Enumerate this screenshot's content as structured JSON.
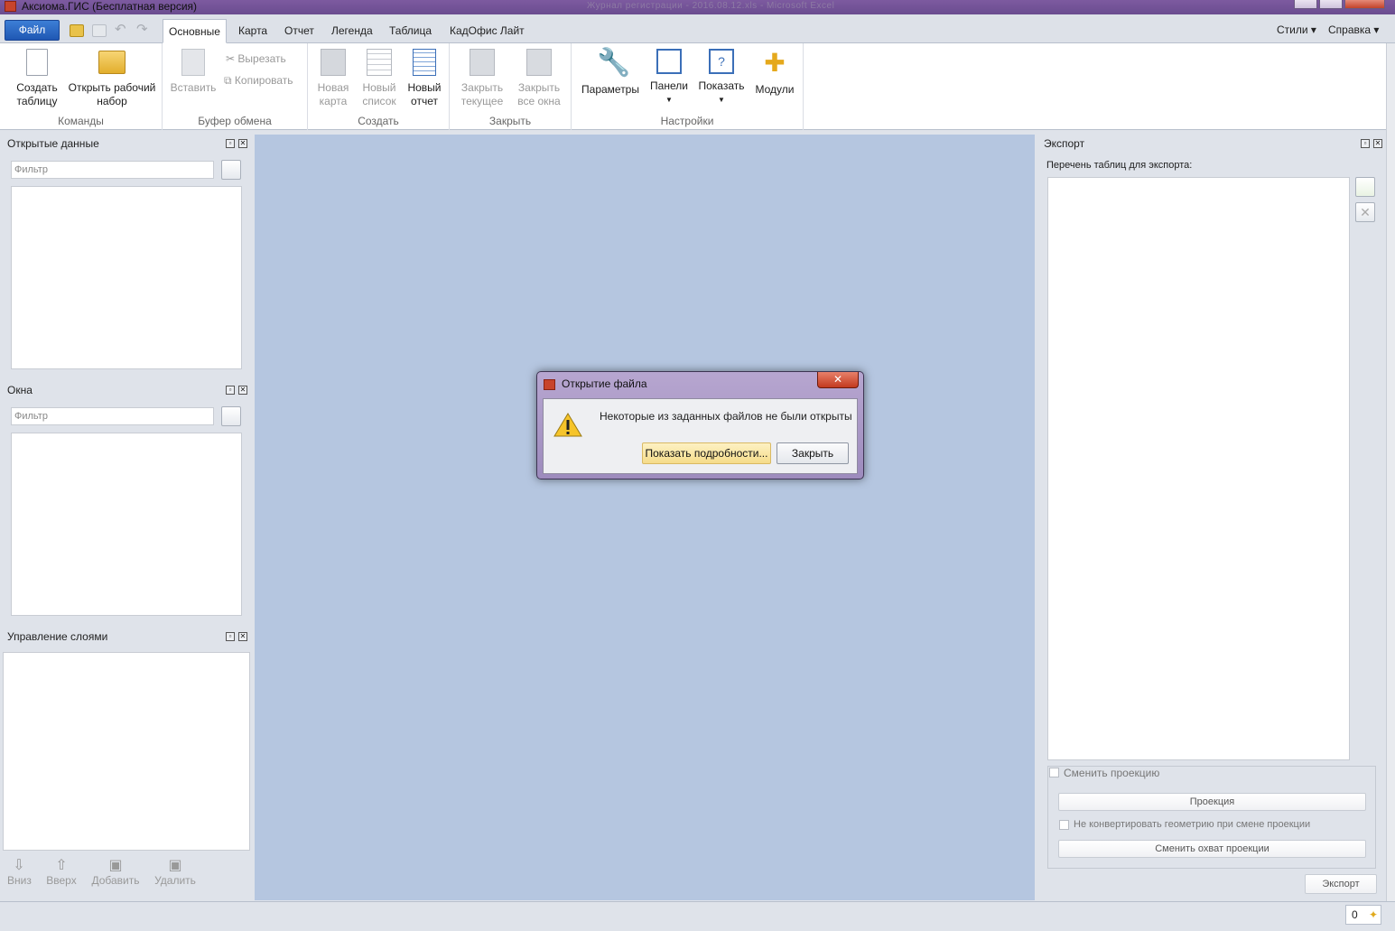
{
  "window": {
    "title": "Аксиома.ГИС (Бесплатная версия)",
    "background_title": "Журнал регистрации - 2016.08.12.xls - Microsoft Excel"
  },
  "ribbon": {
    "file_label": "Файл",
    "tabs": [
      "Основные",
      "Карта",
      "Отчет",
      "Легенда",
      "Таблица",
      "КадОфис Лайт"
    ],
    "active_tab": "Основные",
    "right_menus": [
      "Стили",
      "Справка"
    ],
    "groups": {
      "commands": {
        "label": "Команды",
        "create_table": [
          "Создать",
          "таблицу"
        ],
        "open_workspace": [
          "Открыть рабочий",
          "набор"
        ]
      },
      "clipboard": {
        "label": "Буфер обмена",
        "paste": "Вставить",
        "cut": "Вырезать",
        "copy": "Копировать"
      },
      "create": {
        "label": "Создать",
        "new_map": [
          "Новая",
          "карта"
        ],
        "new_list": [
          "Новый",
          "список"
        ],
        "new_report": [
          "Новый",
          "отчет"
        ]
      },
      "close": {
        "label": "Закрыть",
        "close_current": [
          "Закрыть",
          "текущее"
        ],
        "close_all": [
          "Закрыть",
          "все окна"
        ]
      },
      "settings": {
        "label": "Настройки",
        "params": "Параметры",
        "panels": "Панели",
        "show": "Показать",
        "modules": "Модули"
      }
    }
  },
  "left": {
    "open_data": {
      "title": "Открытые данные",
      "filter_placeholder": "Фильтр"
    },
    "windows": {
      "title": "Окна",
      "filter_placeholder": "Фильтр"
    },
    "layers": {
      "title": "Управление слоями",
      "actions": [
        "Вниз",
        "Вверх",
        "Добавить",
        "Удалить"
      ]
    }
  },
  "export": {
    "title": "Экспорт",
    "list_label": "Перечень таблиц для экспорта:",
    "change_projection": "Сменить проекцию",
    "projection_button": "Проекция",
    "no_convert": "Не конвертировать геометрию при смене проекции",
    "change_extent": "Сменить охват проекции",
    "export_button": "Экспорт"
  },
  "dialog": {
    "title": "Открытие файла",
    "close_glyph": "✕",
    "message": "Некоторые из заданных файлов не были открыты",
    "details_button": "Показать подробности...",
    "close_button": "Закрыть"
  },
  "status": {
    "counter": "0"
  },
  "colors": {
    "workspace": "#b5c6e0",
    "file_button": "#2a65c2",
    "highlight_button": "#f8e3a0"
  }
}
